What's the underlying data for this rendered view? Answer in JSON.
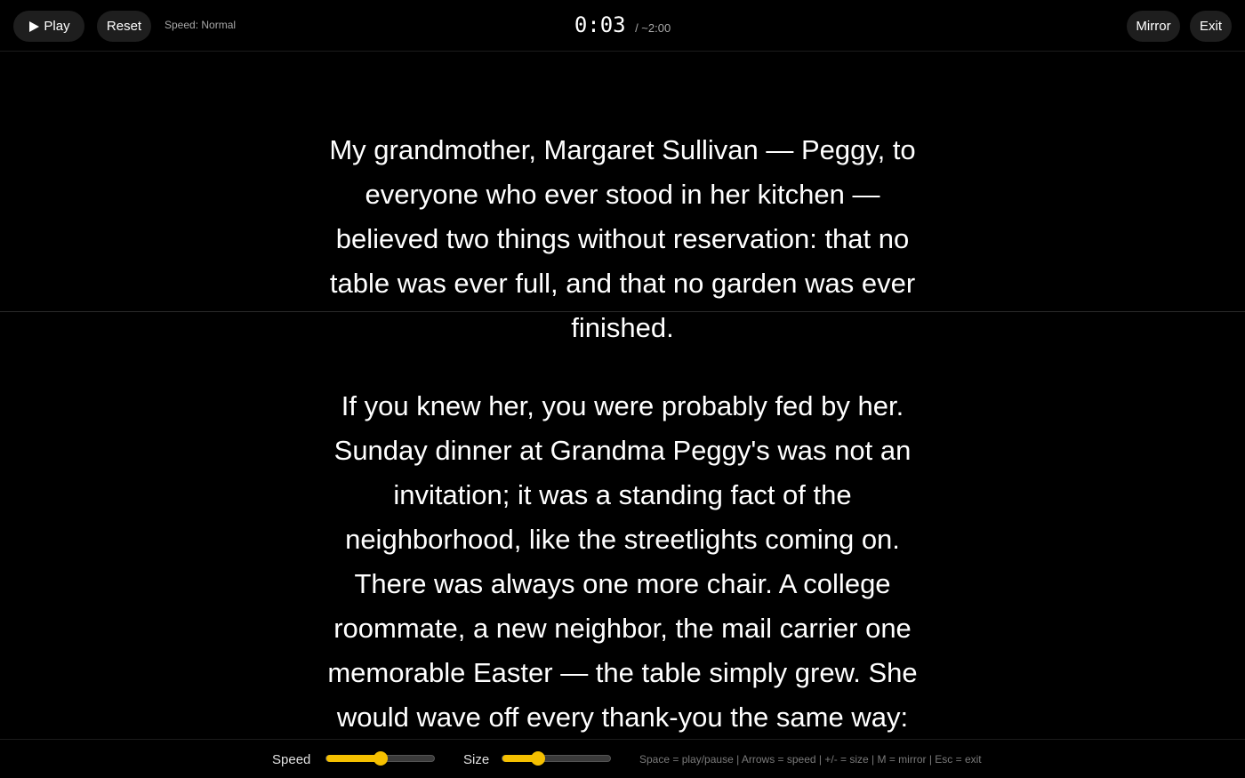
{
  "toolbar": {
    "play_label": "Play",
    "reset_label": "Reset",
    "speed_status": "Speed: Normal",
    "mirror_label": "Mirror",
    "exit_label": "Exit"
  },
  "timer": {
    "elapsed": "0:03",
    "total": "/ ~2:00"
  },
  "script": {
    "paragraphs": [
      "My grandmother, Margaret Sullivan — Peggy, to everyone who ever stood in her kitchen — believed two things without reservation: that no table was ever full, and that no garden was ever finished.",
      "If you knew her, you were probably fed by her. Sunday dinner at Grandma Peggy's was not an invitation; it was a standing fact of the neighborhood, like the streetlights coming on. There was always one more chair. A college roommate, a new neighbor, the mail carrier one memorable Easter — the table simply grew. She would wave off every thank-you the same way:"
    ]
  },
  "controls": {
    "speed_label": "Speed",
    "size_label": "Size",
    "speed_value": 0.5,
    "size_value": 0.33,
    "hints": "Space = play/pause | Arrows = speed | +/- = size | M = mirror | Esc = exit"
  },
  "colors": {
    "accent": "#f5c000",
    "background": "#000000",
    "button_bg": "#1e1e1e"
  },
  "icons": {
    "play": "play-icon"
  }
}
